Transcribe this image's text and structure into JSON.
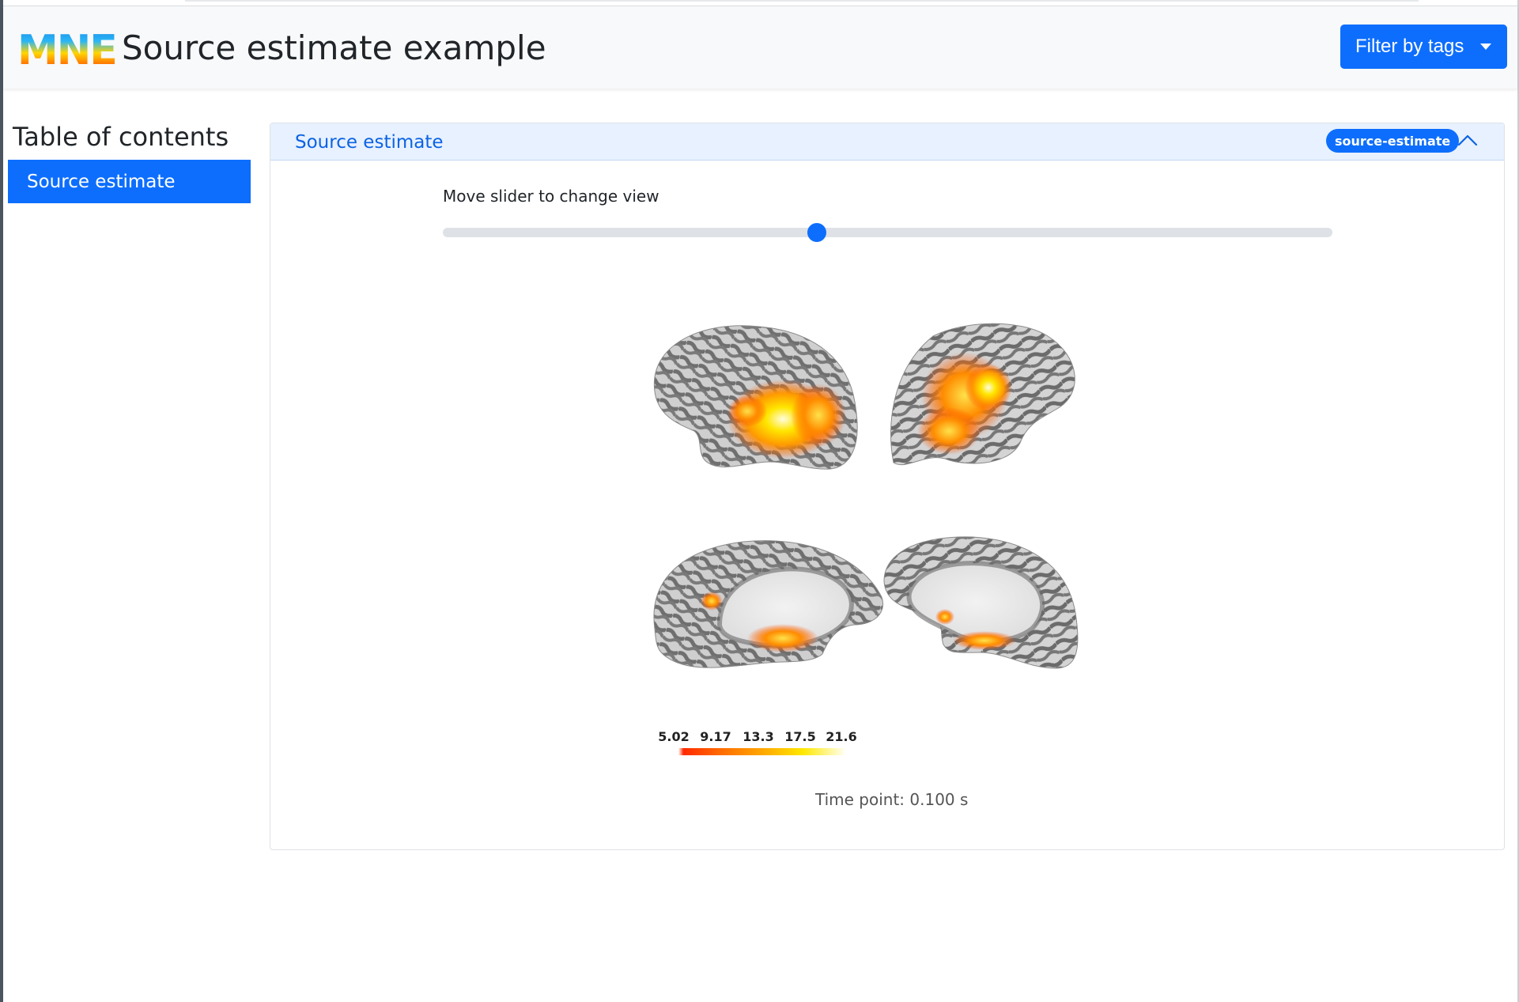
{
  "header": {
    "logo_text": "MNE",
    "title": "Source estimate example",
    "filter_button_label": "Filter by tags"
  },
  "toc": {
    "title": "Table of contents",
    "items": [
      {
        "label": "Source estimate",
        "active": true
      }
    ]
  },
  "section": {
    "title": "Source estimate",
    "tag": "source-estimate",
    "collapse_icon": "chevron-up-icon",
    "slider_label": "Move slider to change view",
    "slider_value_fraction": 0.42,
    "figure": {
      "views": [
        "left-lateral",
        "right-lateral",
        "left-medial",
        "right-medial"
      ],
      "colorbar_ticks": [
        "5.02",
        "9.17",
        "13.3",
        "17.5",
        "21.6"
      ],
      "colormap": "hot"
    },
    "time_point": "Time point: 0.100 s"
  },
  "colors": {
    "accent": "#0d6efd",
    "header_bg": "#f8f9fa",
    "card_header_bg": "#e7f1ff",
    "card_header_text": "#0c63e4",
    "cortex_dark": "#6c6c6c",
    "cortex_light": "#d2d2d2",
    "activation": "#ff8c00"
  }
}
